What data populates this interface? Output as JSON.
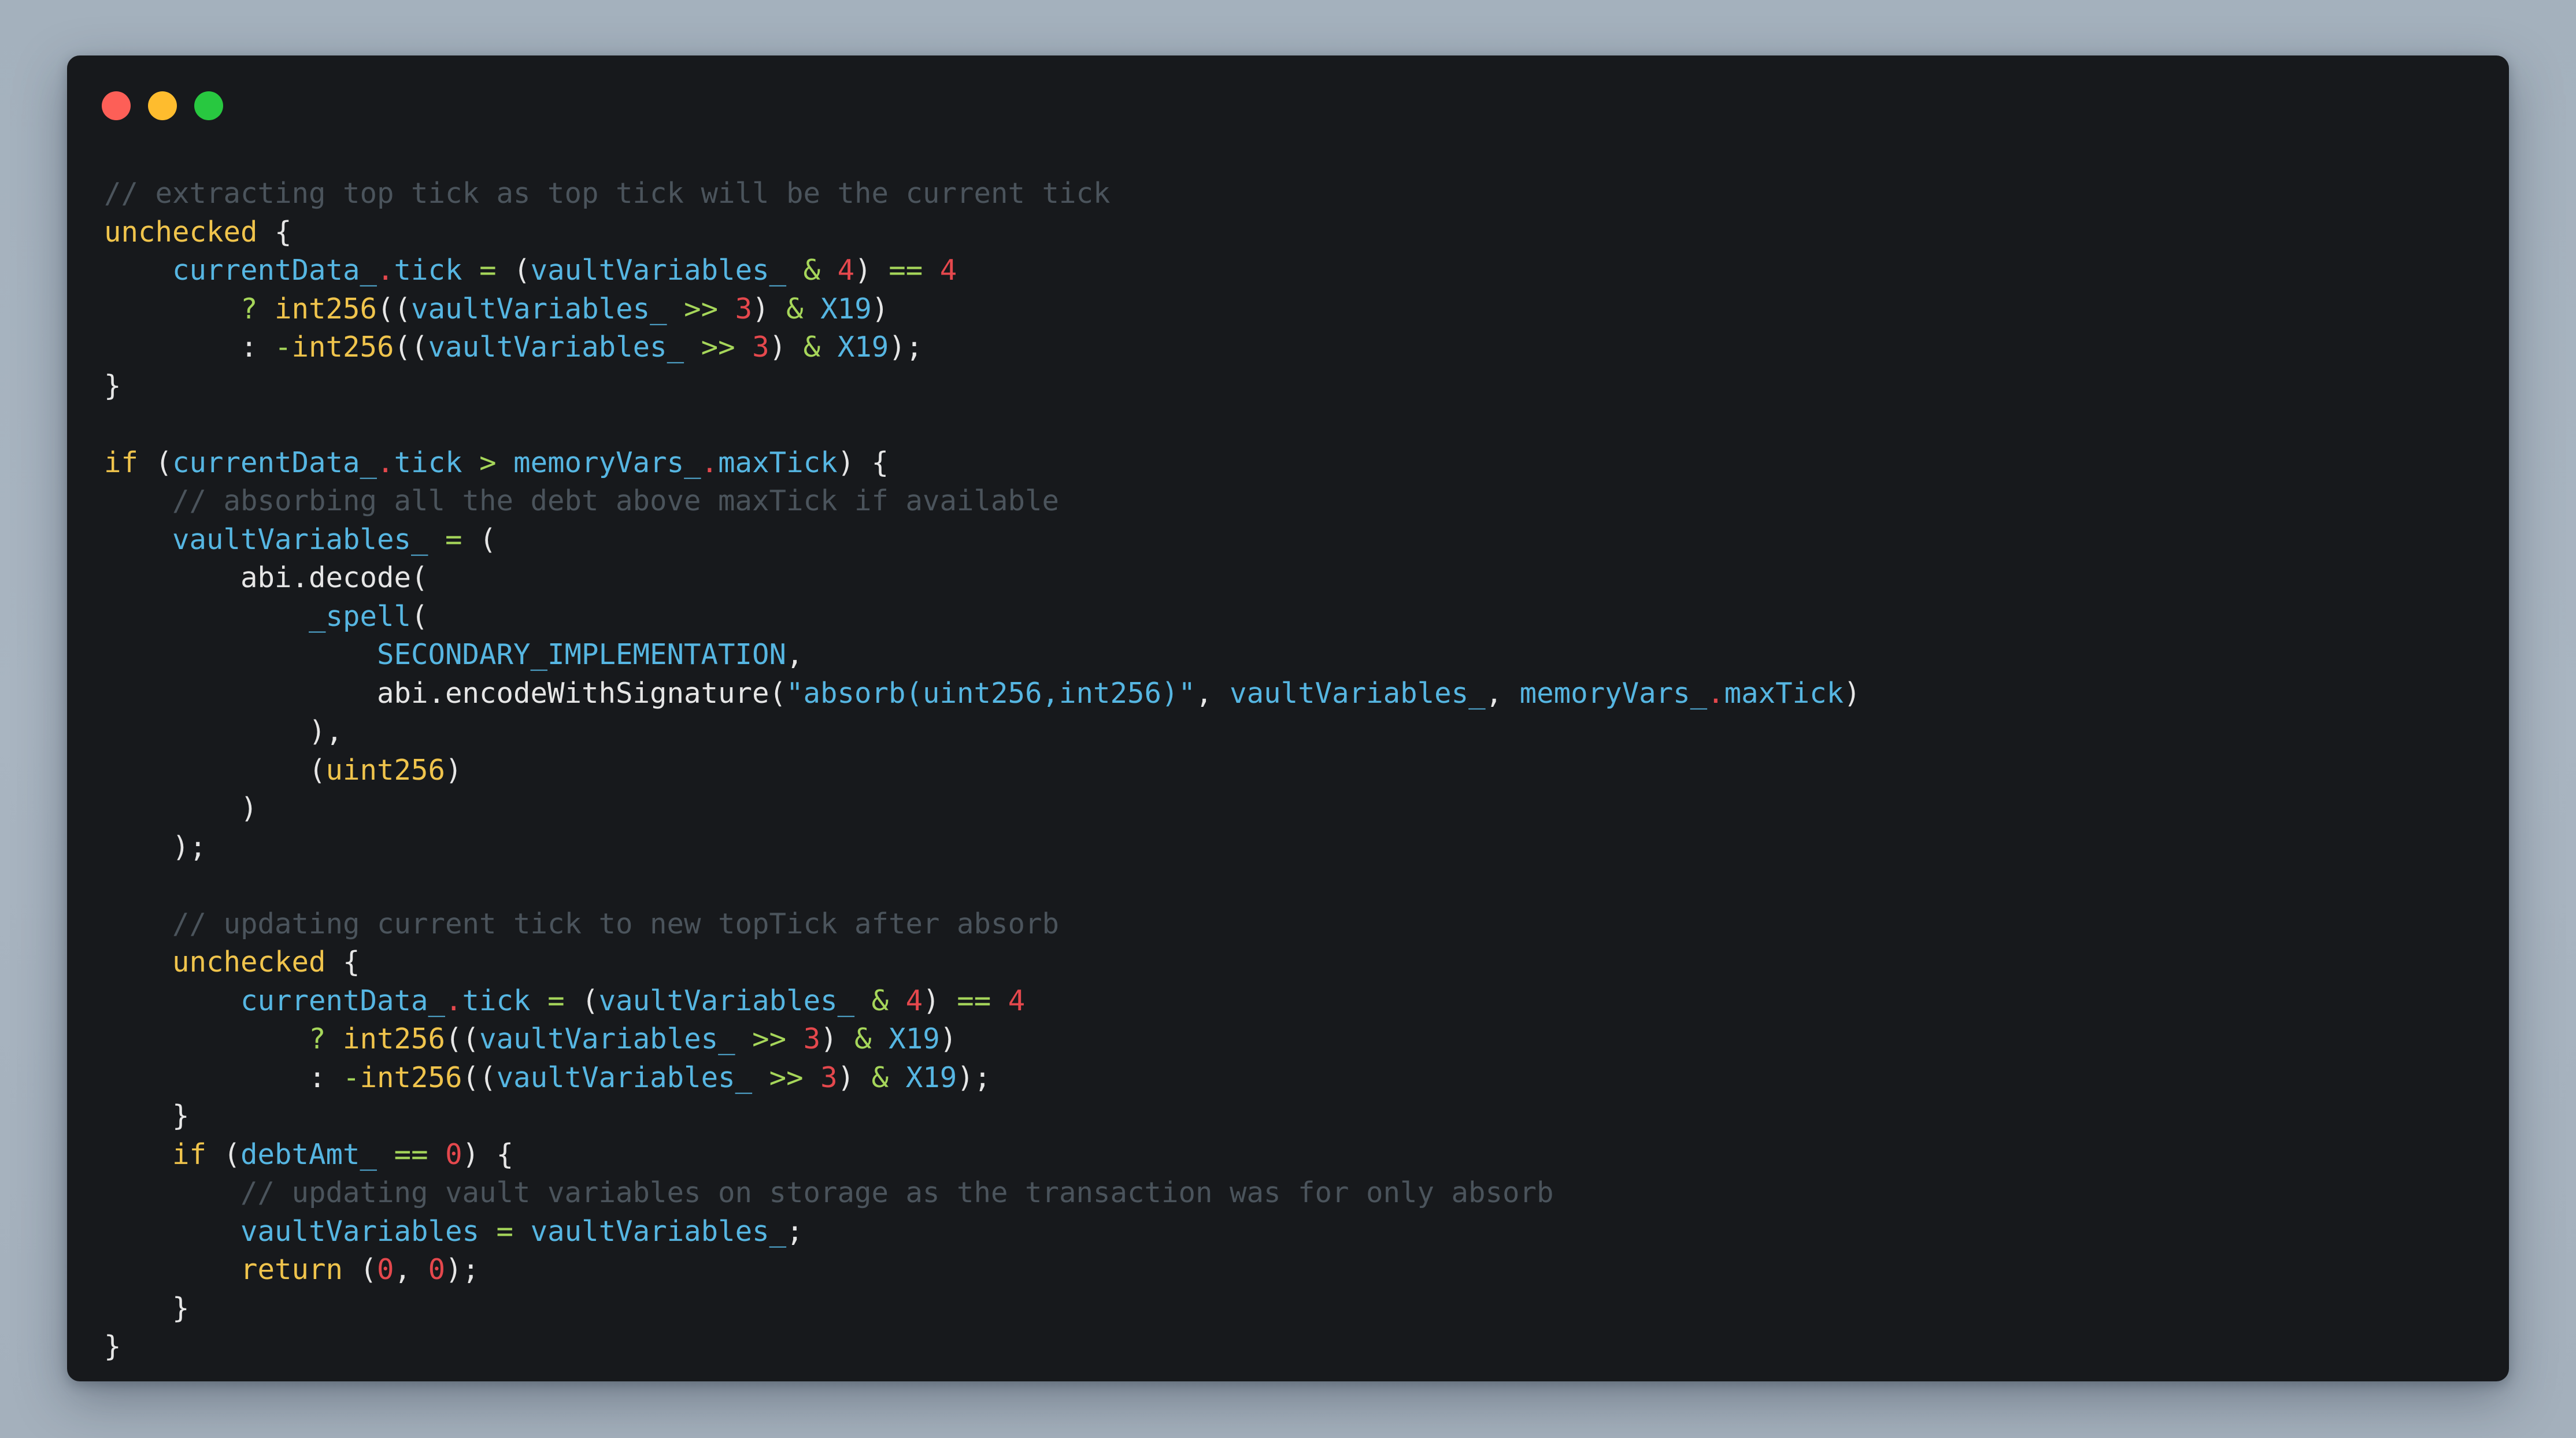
{
  "window": {
    "controls": [
      {
        "name": "close",
        "color": "#fd5f57"
      },
      {
        "name": "minimize",
        "color": "#febc2e"
      },
      {
        "name": "zoom",
        "color": "#28c840"
      }
    ]
  },
  "code": {
    "language": "Solidity",
    "lines": [
      [
        {
          "t": "// extracting top tick as top tick will be the current tick",
          "k": "comment"
        }
      ],
      [
        {
          "t": "unchecked",
          "k": "keyword"
        },
        {
          "t": " {",
          "k": "plain"
        }
      ],
      [
        {
          "t": "    ",
          "k": "plain"
        },
        {
          "t": "currentData_",
          "k": "ident"
        },
        {
          "t": ".",
          "k": "dot"
        },
        {
          "t": "tick",
          "k": "ident"
        },
        {
          "t": " ",
          "k": "plain"
        },
        {
          "t": "=",
          "k": "operator"
        },
        {
          "t": " (",
          "k": "plain"
        },
        {
          "t": "vaultVariables_",
          "k": "ident"
        },
        {
          "t": " ",
          "k": "plain"
        },
        {
          "t": "&",
          "k": "operator"
        },
        {
          "t": " ",
          "k": "plain"
        },
        {
          "t": "4",
          "k": "number"
        },
        {
          "t": ") ",
          "k": "plain"
        },
        {
          "t": "==",
          "k": "operator"
        },
        {
          "t": " ",
          "k": "plain"
        },
        {
          "t": "4",
          "k": "number"
        }
      ],
      [
        {
          "t": "        ",
          "k": "plain"
        },
        {
          "t": "?",
          "k": "operator"
        },
        {
          "t": " ",
          "k": "plain"
        },
        {
          "t": "int256",
          "k": "func"
        },
        {
          "t": "((",
          "k": "plain"
        },
        {
          "t": "vaultVariables_",
          "k": "ident"
        },
        {
          "t": " ",
          "k": "plain"
        },
        {
          "t": ">>",
          "k": "operator"
        },
        {
          "t": " ",
          "k": "plain"
        },
        {
          "t": "3",
          "k": "number"
        },
        {
          "t": ") ",
          "k": "plain"
        },
        {
          "t": "&",
          "k": "operator"
        },
        {
          "t": " ",
          "k": "plain"
        },
        {
          "t": "X19",
          "k": "ident"
        },
        {
          "t": ")",
          "k": "plain"
        }
      ],
      [
        {
          "t": "        : ",
          "k": "plain"
        },
        {
          "t": "-",
          "k": "operator"
        },
        {
          "t": "int256",
          "k": "func"
        },
        {
          "t": "((",
          "k": "plain"
        },
        {
          "t": "vaultVariables_",
          "k": "ident"
        },
        {
          "t": " ",
          "k": "plain"
        },
        {
          "t": ">>",
          "k": "operator"
        },
        {
          "t": " ",
          "k": "plain"
        },
        {
          "t": "3",
          "k": "number"
        },
        {
          "t": ") ",
          "k": "plain"
        },
        {
          "t": "&",
          "k": "operator"
        },
        {
          "t": " ",
          "k": "plain"
        },
        {
          "t": "X19",
          "k": "ident"
        },
        {
          "t": ");",
          "k": "plain"
        }
      ],
      [
        {
          "t": "}",
          "k": "plain"
        }
      ],
      [],
      [
        {
          "t": "if",
          "k": "keyword"
        },
        {
          "t": " (",
          "k": "plain"
        },
        {
          "t": "currentData_",
          "k": "ident"
        },
        {
          "t": ".",
          "k": "dot"
        },
        {
          "t": "tick",
          "k": "ident"
        },
        {
          "t": " ",
          "k": "plain"
        },
        {
          "t": ">",
          "k": "operator"
        },
        {
          "t": " ",
          "k": "plain"
        },
        {
          "t": "memoryVars_",
          "k": "ident"
        },
        {
          "t": ".",
          "k": "dot"
        },
        {
          "t": "maxTick",
          "k": "ident"
        },
        {
          "t": ") {",
          "k": "plain"
        }
      ],
      [
        {
          "t": "    ",
          "k": "plain"
        },
        {
          "t": "// absorbing all the debt above maxTick if available",
          "k": "comment"
        }
      ],
      [
        {
          "t": "    ",
          "k": "plain"
        },
        {
          "t": "vaultVariables_",
          "k": "ident"
        },
        {
          "t": " ",
          "k": "plain"
        },
        {
          "t": "=",
          "k": "operator"
        },
        {
          "t": " (",
          "k": "plain"
        }
      ],
      [
        {
          "t": "        abi.decode(",
          "k": "plain"
        }
      ],
      [
        {
          "t": "            ",
          "k": "plain"
        },
        {
          "t": "_spell",
          "k": "ident"
        },
        {
          "t": "(",
          "k": "plain"
        }
      ],
      [
        {
          "t": "                ",
          "k": "plain"
        },
        {
          "t": "SECONDARY_IMPLEMENTATION",
          "k": "ident"
        },
        {
          "t": ",",
          "k": "plain"
        }
      ],
      [
        {
          "t": "                abi.encodeWithSignature(",
          "k": "plain"
        },
        {
          "t": "\"absorb(uint256,int256)\"",
          "k": "string"
        },
        {
          "t": ", ",
          "k": "plain"
        },
        {
          "t": "vaultVariables_",
          "k": "ident"
        },
        {
          "t": ", ",
          "k": "plain"
        },
        {
          "t": "memoryVars_",
          "k": "ident"
        },
        {
          "t": ".",
          "k": "dot"
        },
        {
          "t": "maxTick",
          "k": "ident"
        },
        {
          "t": ")",
          "k": "plain"
        }
      ],
      [
        {
          "t": "            ),",
          "k": "plain"
        }
      ],
      [
        {
          "t": "            (",
          "k": "plain"
        },
        {
          "t": "uint256",
          "k": "func"
        },
        {
          "t": ")",
          "k": "plain"
        }
      ],
      [
        {
          "t": "        )",
          "k": "plain"
        }
      ],
      [
        {
          "t": "    );",
          "k": "plain"
        }
      ],
      [],
      [
        {
          "t": "    ",
          "k": "plain"
        },
        {
          "t": "// updating current tick to new topTick after absorb",
          "k": "comment"
        }
      ],
      [
        {
          "t": "    ",
          "k": "plain"
        },
        {
          "t": "unchecked",
          "k": "keyword"
        },
        {
          "t": " {",
          "k": "plain"
        }
      ],
      [
        {
          "t": "        ",
          "k": "plain"
        },
        {
          "t": "currentData_",
          "k": "ident"
        },
        {
          "t": ".",
          "k": "dot"
        },
        {
          "t": "tick",
          "k": "ident"
        },
        {
          "t": " ",
          "k": "plain"
        },
        {
          "t": "=",
          "k": "operator"
        },
        {
          "t": " (",
          "k": "plain"
        },
        {
          "t": "vaultVariables_",
          "k": "ident"
        },
        {
          "t": " ",
          "k": "plain"
        },
        {
          "t": "&",
          "k": "operator"
        },
        {
          "t": " ",
          "k": "plain"
        },
        {
          "t": "4",
          "k": "number"
        },
        {
          "t": ") ",
          "k": "plain"
        },
        {
          "t": "==",
          "k": "operator"
        },
        {
          "t": " ",
          "k": "plain"
        },
        {
          "t": "4",
          "k": "number"
        }
      ],
      [
        {
          "t": "            ",
          "k": "plain"
        },
        {
          "t": "?",
          "k": "operator"
        },
        {
          "t": " ",
          "k": "plain"
        },
        {
          "t": "int256",
          "k": "func"
        },
        {
          "t": "((",
          "k": "plain"
        },
        {
          "t": "vaultVariables_",
          "k": "ident"
        },
        {
          "t": " ",
          "k": "plain"
        },
        {
          "t": ">>",
          "k": "operator"
        },
        {
          "t": " ",
          "k": "plain"
        },
        {
          "t": "3",
          "k": "number"
        },
        {
          "t": ") ",
          "k": "plain"
        },
        {
          "t": "&",
          "k": "operator"
        },
        {
          "t": " ",
          "k": "plain"
        },
        {
          "t": "X19",
          "k": "ident"
        },
        {
          "t": ")",
          "k": "plain"
        }
      ],
      [
        {
          "t": "            : ",
          "k": "plain"
        },
        {
          "t": "-",
          "k": "operator"
        },
        {
          "t": "int256",
          "k": "func"
        },
        {
          "t": "((",
          "k": "plain"
        },
        {
          "t": "vaultVariables_",
          "k": "ident"
        },
        {
          "t": " ",
          "k": "plain"
        },
        {
          "t": ">>",
          "k": "operator"
        },
        {
          "t": " ",
          "k": "plain"
        },
        {
          "t": "3",
          "k": "number"
        },
        {
          "t": ") ",
          "k": "plain"
        },
        {
          "t": "&",
          "k": "operator"
        },
        {
          "t": " ",
          "k": "plain"
        },
        {
          "t": "X19",
          "k": "ident"
        },
        {
          "t": ");",
          "k": "plain"
        }
      ],
      [
        {
          "t": "    }",
          "k": "plain"
        }
      ],
      [
        {
          "t": "    ",
          "k": "plain"
        },
        {
          "t": "if",
          "k": "keyword"
        },
        {
          "t": " (",
          "k": "plain"
        },
        {
          "t": "debtAmt_",
          "k": "ident"
        },
        {
          "t": " ",
          "k": "plain"
        },
        {
          "t": "==",
          "k": "operator"
        },
        {
          "t": " ",
          "k": "plain"
        },
        {
          "t": "0",
          "k": "number"
        },
        {
          "t": ") {",
          "k": "plain"
        }
      ],
      [
        {
          "t": "        ",
          "k": "plain"
        },
        {
          "t": "// updating vault variables on storage as the transaction was for only absorb",
          "k": "comment"
        }
      ],
      [
        {
          "t": "        ",
          "k": "plain"
        },
        {
          "t": "vaultVariables",
          "k": "ident"
        },
        {
          "t": " ",
          "k": "plain"
        },
        {
          "t": "=",
          "k": "operator"
        },
        {
          "t": " ",
          "k": "plain"
        },
        {
          "t": "vaultVariables_",
          "k": "ident"
        },
        {
          "t": ";",
          "k": "plain"
        }
      ],
      [
        {
          "t": "        ",
          "k": "plain"
        },
        {
          "t": "return",
          "k": "keyword"
        },
        {
          "t": " (",
          "k": "plain"
        },
        {
          "t": "0",
          "k": "number"
        },
        {
          "t": ", ",
          "k": "plain"
        },
        {
          "t": "0",
          "k": "number"
        },
        {
          "t": ");",
          "k": "plain"
        }
      ],
      [
        {
          "t": "    }",
          "k": "plain"
        }
      ],
      [
        {
          "t": "}",
          "k": "plain"
        }
      ]
    ]
  },
  "theme": {
    "background": "#17191c",
    "comment": "#4b545c",
    "keyword": "#f0c44c",
    "identifier": "#56b6e2",
    "number": "#e5484d",
    "operator": "#a6d65a",
    "plain": "#e6e6e6"
  }
}
